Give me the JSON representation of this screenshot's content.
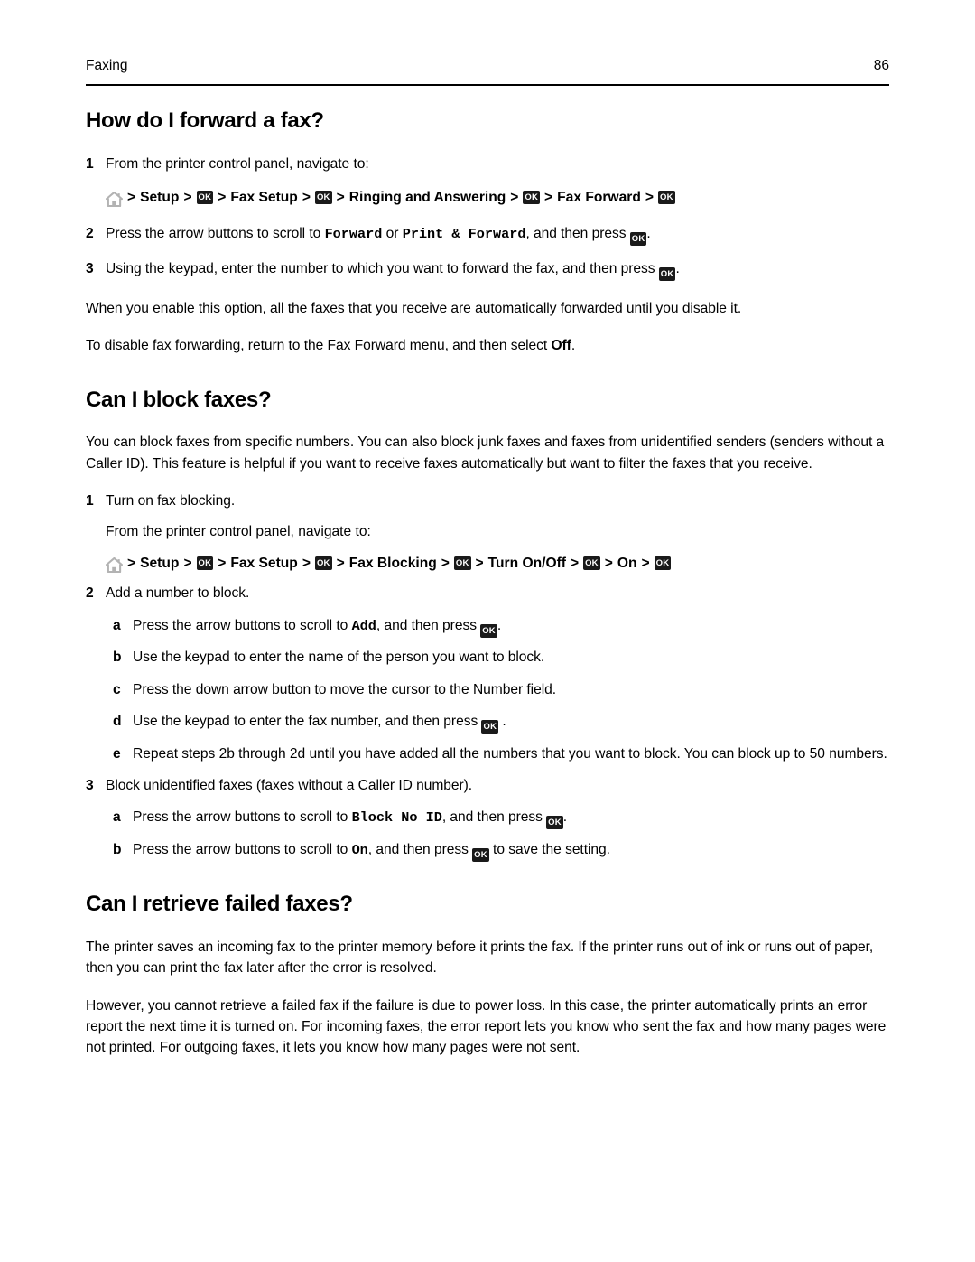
{
  "header": {
    "chapter": "Faxing",
    "page_number": "86"
  },
  "icons": {
    "home": "home-icon",
    "ok": "OK"
  },
  "sections": [
    {
      "title": "How do I forward a fax?",
      "step1": {
        "marker": "1",
        "text": "From the printer control panel, navigate to:"
      },
      "navpath": {
        "crumbs": [
          "Setup",
          "Fax Setup",
          "Ringing and Answering",
          "Fax Forward"
        ],
        "separator": ">"
      },
      "step2": {
        "marker": "2",
        "pre": "Press the arrow buttons to scroll to ",
        "mono1": "Forward",
        "mid": " or ",
        "mono2": "Print & Forward",
        "post": ", and then press ",
        "end": "."
      },
      "step3": {
        "marker": "3",
        "pre": "Using the keypad, enter the number to which you want to forward the fax, and then press ",
        "end": "."
      },
      "para1": "When you enable this option, all the faxes that you receive are automatically forwarded until you disable it.",
      "para2_pre": "To disable fax forwarding, return to the Fax Forward menu, and then select ",
      "para2_bold": "Off",
      "para2_post": "."
    },
    {
      "title": "Can I block faxes?",
      "intro": "You can block faxes from specific numbers. You can also block junk faxes and faxes from unidentified senders (senders without a Caller ID). This feature is helpful if you want to receive faxes automatically but want to filter the faxes that you receive.",
      "step1": {
        "marker": "1",
        "text": "Turn on fax blocking.",
        "cont": "From the printer control panel, navigate to:"
      },
      "navpath": {
        "crumbs": [
          "Setup",
          "Fax Setup",
          "Fax Blocking",
          "Turn On/Off",
          "On"
        ],
        "separator": ">"
      },
      "step2": {
        "marker": "2",
        "text": "Add a number to block.",
        "subs": [
          {
            "marker": "a",
            "pre": "Press the arrow buttons to scroll to ",
            "mono": "Add",
            "post": ", and then press ",
            "end": "."
          },
          {
            "marker": "b",
            "text": "Use the keypad to enter the name of the person you want to block."
          },
          {
            "marker": "c",
            "text": "Press the down arrow button to move the cursor to the Number field."
          },
          {
            "marker": "d",
            "pre": "Use the keypad to enter the fax number, and then press ",
            "end": " ."
          },
          {
            "marker": "e",
            "text": "Repeat steps 2b through 2d until you have added all the numbers that you want to block. You can block up to 50 numbers."
          }
        ]
      },
      "step3": {
        "marker": "3",
        "text": "Block unidentified faxes (faxes without a Caller ID number).",
        "subs": [
          {
            "marker": "a",
            "pre": "Press the arrow buttons to scroll to ",
            "mono": "Block No ID",
            "post": ", and then press ",
            "end": "."
          },
          {
            "marker": "b",
            "pre": "Press the arrow buttons to scroll to ",
            "mono": "On",
            "post": ", and then press ",
            "end": " to save the setting."
          }
        ]
      }
    },
    {
      "title": "Can I retrieve failed faxes?",
      "para1": "The printer saves an incoming fax to the printer memory before it prints the fax. If the printer runs out of ink or runs out of paper, then you can print the fax later after the error is resolved.",
      "para2": "However, you cannot retrieve a failed fax if the failure is due to power loss. In this case, the printer automatically prints an error report the next time it is turned on. For incoming faxes, the error report lets you know who sent the fax and how many pages were not printed. For outgoing faxes, it lets you know how many pages were not sent."
    }
  ]
}
